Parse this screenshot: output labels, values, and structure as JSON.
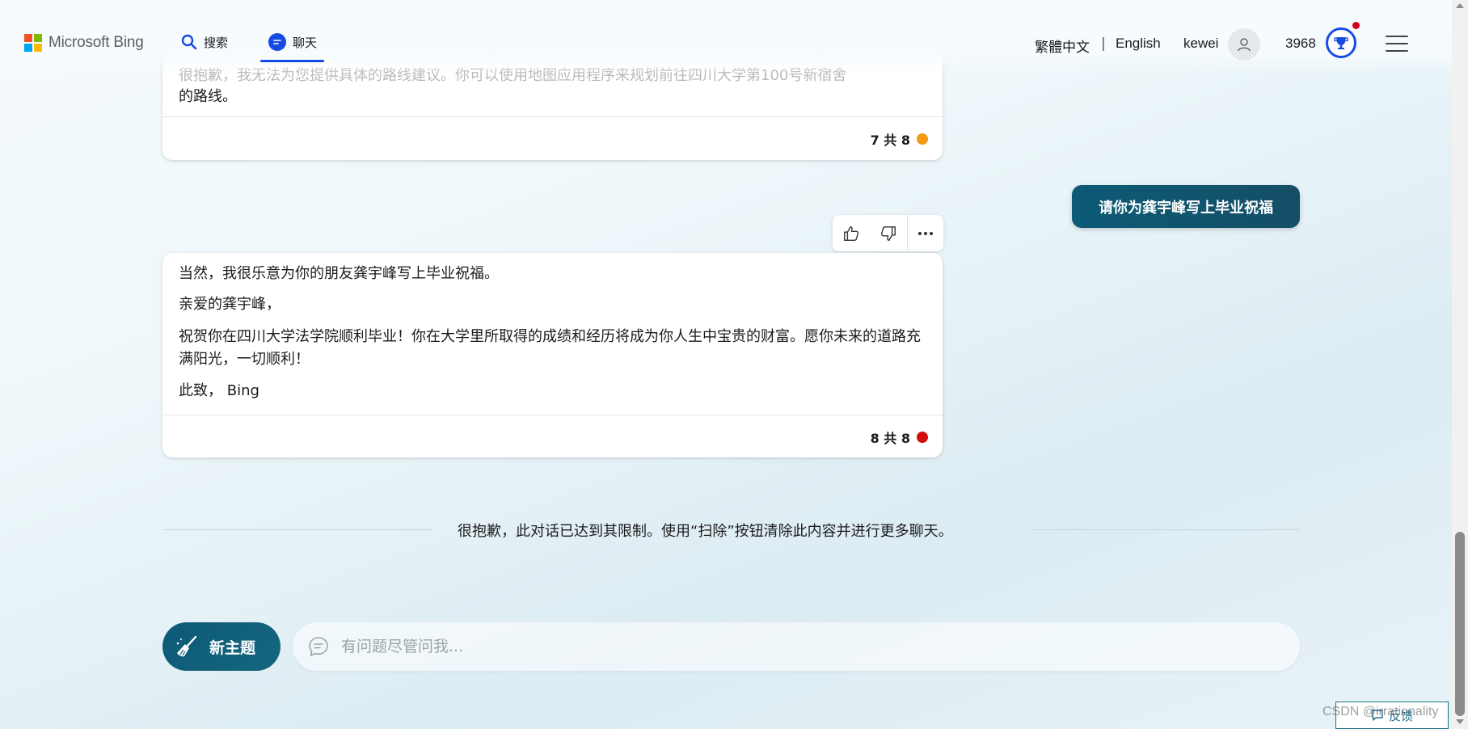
{
  "header": {
    "brand": "Microsoft Bing",
    "tabs": [
      {
        "label": "搜索",
        "icon": "search-icon"
      },
      {
        "label": "聊天",
        "icon": "chat-bubble-icon",
        "active": true
      }
    ],
    "lang_traditional": "繁體中文",
    "lang_separator": "|",
    "lang_english": "English",
    "user_name": "kewei",
    "reward_points": "3968",
    "colors": {
      "accent": "#174ae4",
      "notification": "#d4001c"
    }
  },
  "conversation": {
    "previous_bot": {
      "faded_line": "很抱歉，我无法为您提供具体的路线建议。你可以使用地图应用程序来规划前往四川大学第100号新宿舍",
      "text": "的路线。",
      "counter": "7 共 8",
      "counter_color": "#f29a11"
    },
    "user_message": "请你为龚宇峰写上毕业祝福",
    "bot_reply": {
      "paragraphs": [
        "当然，我很乐意为你的朋友龚宇峰写上毕业祝福。",
        "亲爱的龚宇峰，",
        "祝贺你在四川大学法学院顺利毕业！你在大学里所取得的成绩和经历将成为你人生中宝贵的财富。愿你未来的道路充满阳光，一切顺利！",
        "此致， Bing"
      ],
      "counter": "8 共 8",
      "counter_color": "#d10d0d"
    },
    "limit_notice": "很抱歉，此对话已达到其限制。使用“扫除”按钮清除此内容并进行更多聊天。"
  },
  "composer": {
    "new_topic_label": "新主题",
    "input_placeholder": "有问题尽管问我...",
    "brand_color": "#0c5a76"
  },
  "footer": {
    "feedback_label": "反馈",
    "watermark": "CSDN @irrationality"
  }
}
